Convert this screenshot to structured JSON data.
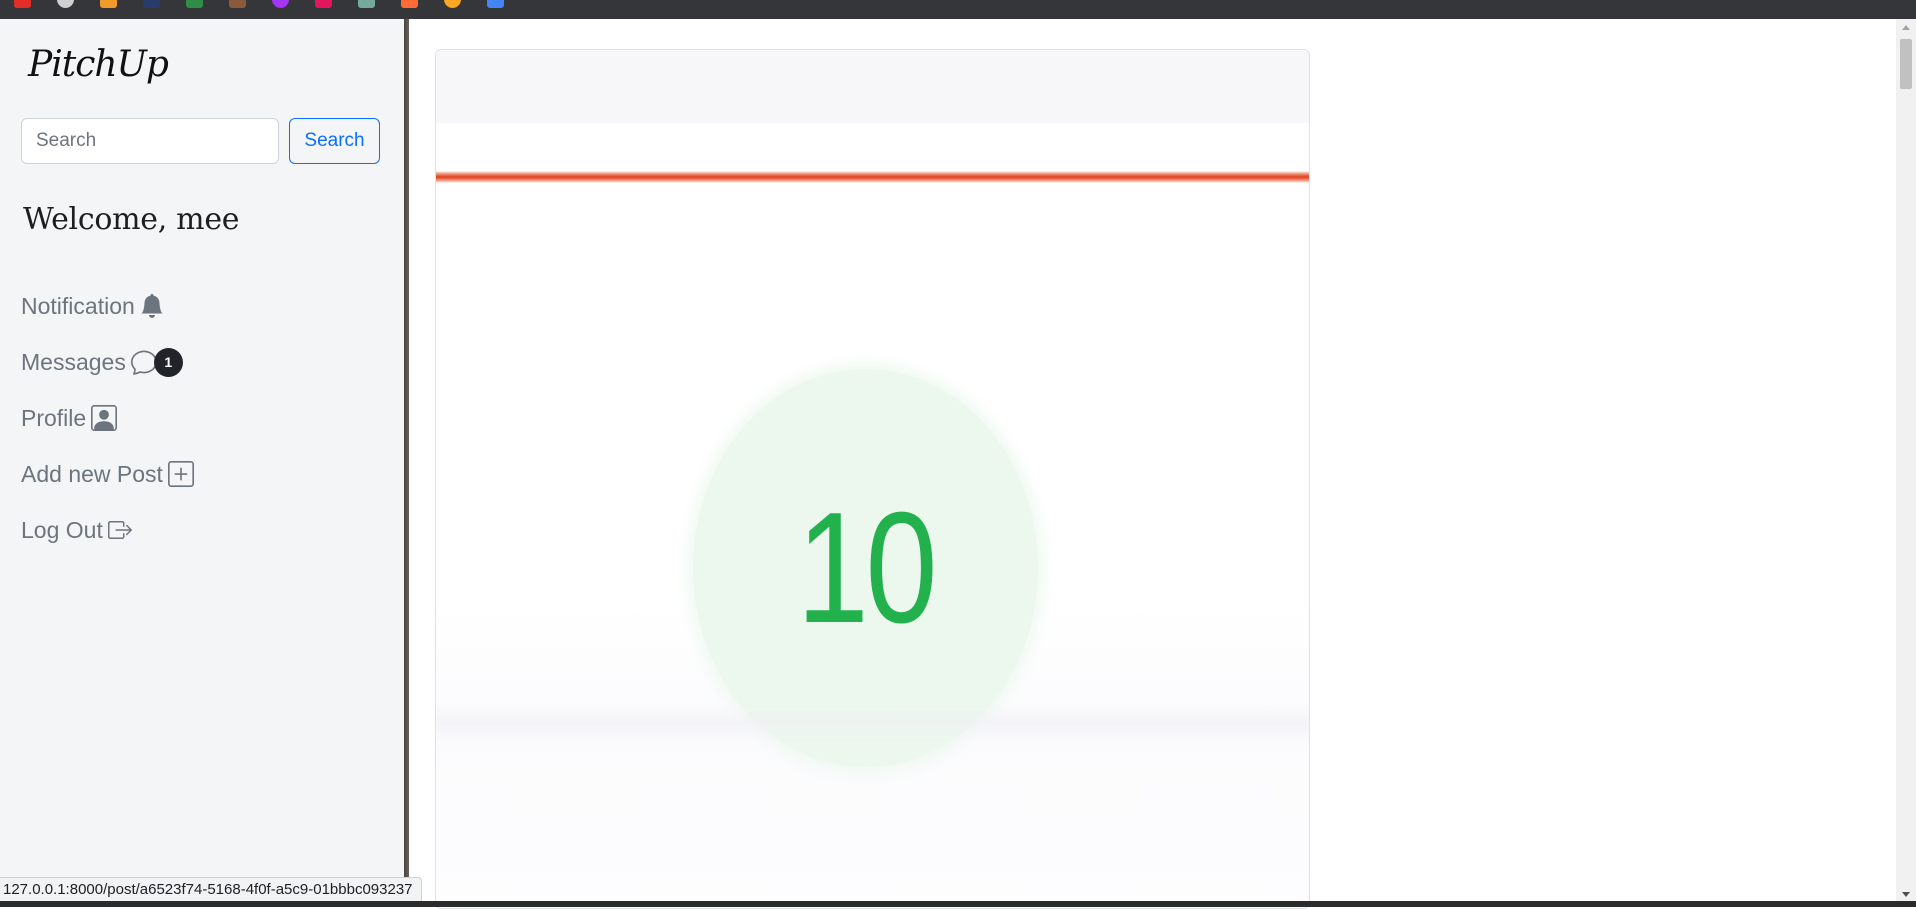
{
  "app": {
    "logo": "PitchUp"
  },
  "search": {
    "placeholder": "Search",
    "button_label": "Search"
  },
  "welcome": "Welcome, mee",
  "nav": {
    "notification": "Notification",
    "messages": "Messages",
    "messages_badge": "1",
    "profile": "Profile",
    "add_post": "Add new Post",
    "logout": "Log Out"
  },
  "post": {
    "image_number": "10"
  },
  "status_url": "127.0.0.1:8000/post/a6523f74-5168-4f0f-a5c9-01bbbc093237",
  "icons": {
    "notification": "bell-icon",
    "messages": "chat-icon",
    "profile": "person-square-icon",
    "add_post": "plus-square-icon",
    "logout": "box-arrow-right-icon"
  },
  "colors": {
    "primary": "#0d6efd",
    "muted": "#6c757d",
    "sidebar_bg": "#f4f5f7",
    "number_green": "#22b14c",
    "red_line": "#e43d1c"
  }
}
